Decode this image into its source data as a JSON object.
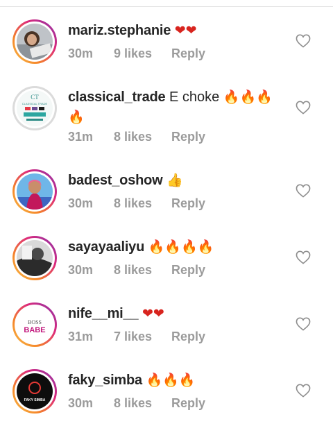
{
  "colors": {
    "text": "#262626",
    "meta": "#9b9b9b",
    "fire": "#ff8a00",
    "heart_red": "#d8241e",
    "thumb": "#f6b600",
    "ring_start": "#f9c34a",
    "ring_end": "#8134af"
  },
  "comments": [
    {
      "username": "mariz.stephanie",
      "text": "",
      "emoji": "❤❤",
      "time": "30m",
      "likes": "9 likes",
      "reply": "Reply"
    },
    {
      "username": "classical_trade",
      "text": "E choke",
      "emoji": "🔥🔥🔥",
      "emoji2": "🔥",
      "time": "31m",
      "likes": "8 likes",
      "reply": "Reply"
    },
    {
      "username": "badest_oshow",
      "text": "",
      "emoji": "👍",
      "time": "30m",
      "likes": "8 likes",
      "reply": "Reply"
    },
    {
      "username": "sayayaaliyu",
      "text": "",
      "emoji": "🔥🔥🔥🔥",
      "time": "30m",
      "likes": "8 likes",
      "reply": "Reply"
    },
    {
      "username": "nife__mi__",
      "text": "",
      "emoji": "❤❤",
      "time": "31m",
      "likes": "7 likes",
      "reply": "Reply"
    },
    {
      "username": "faky_simba",
      "text": "",
      "emoji": "🔥🔥🔥",
      "time": "30m",
      "likes": "8 likes",
      "reply": "Reply"
    }
  ],
  "avatar_text": {
    "classical": {
      "logo": "CT",
      "line1": "CLASSICAL TRADE"
    },
    "boss": {
      "line1": "BOSS",
      "line2": "BABE"
    },
    "faky": {
      "label": "FAKY SIMBA"
    }
  },
  "icons": {
    "like": "heart-outline-icon"
  }
}
